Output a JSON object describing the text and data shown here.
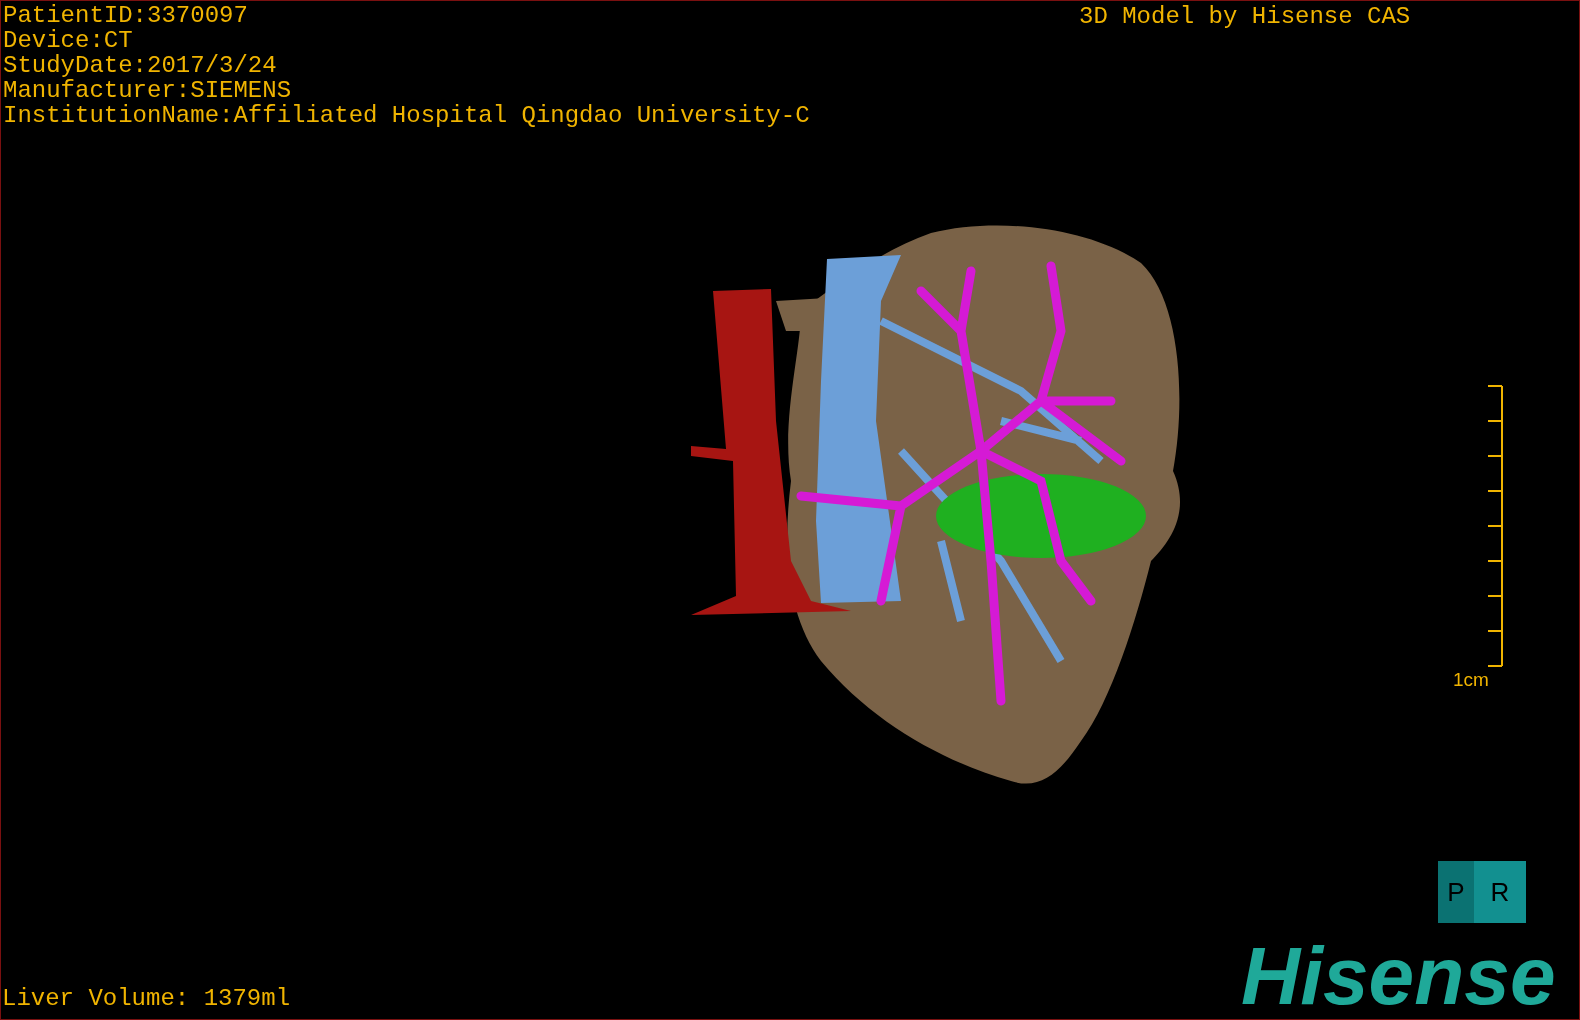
{
  "study_info": [
    "PatientID:3370097",
    "Device:CT",
    "StudyDate:2017/3/24",
    "Manufacturer:SIEMENS",
    "InstitutionName:Affiliated Hospital Qingdao University-C"
  ],
  "model_credit": "3D Model by Hisense CAS",
  "scale_bar": {
    "label": "1cm"
  },
  "orientation_cube": {
    "faces": [
      "P",
      "R"
    ]
  },
  "liver_volume": "Liver Volume: 1379ml",
  "logo": "Hisense"
}
